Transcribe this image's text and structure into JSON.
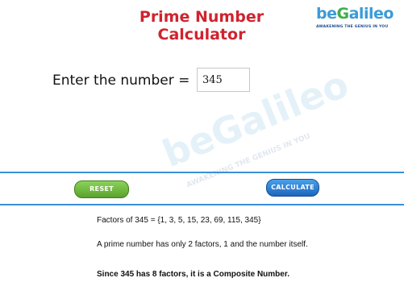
{
  "header": {
    "title_line1": "Prime Number",
    "title_line2": "Calculator"
  },
  "logo": {
    "prefix": "be",
    "g": "G",
    "suffix": "alileo",
    "tagline": "AWAKENING THE GENIUS IN YOU"
  },
  "input": {
    "label": "Enter the number =",
    "value": "345"
  },
  "buttons": {
    "reset_label": "RESET",
    "calculate_label": "CALCULATE"
  },
  "result": {
    "factors_line": "Factors of 345 = {1, 3, 5, 15, 23, 69, 115, 345}",
    "definition_line": "A prime number has only 2 factors, 1 and the number itself.",
    "conclusion_line": "Since 345 has 8 factors, it is a Composite Number."
  },
  "colors": {
    "title": "#d0232e",
    "rule": "#3a8fd8",
    "reset_button": "#6cb83a",
    "calculate_button": "#2a7fd0"
  }
}
